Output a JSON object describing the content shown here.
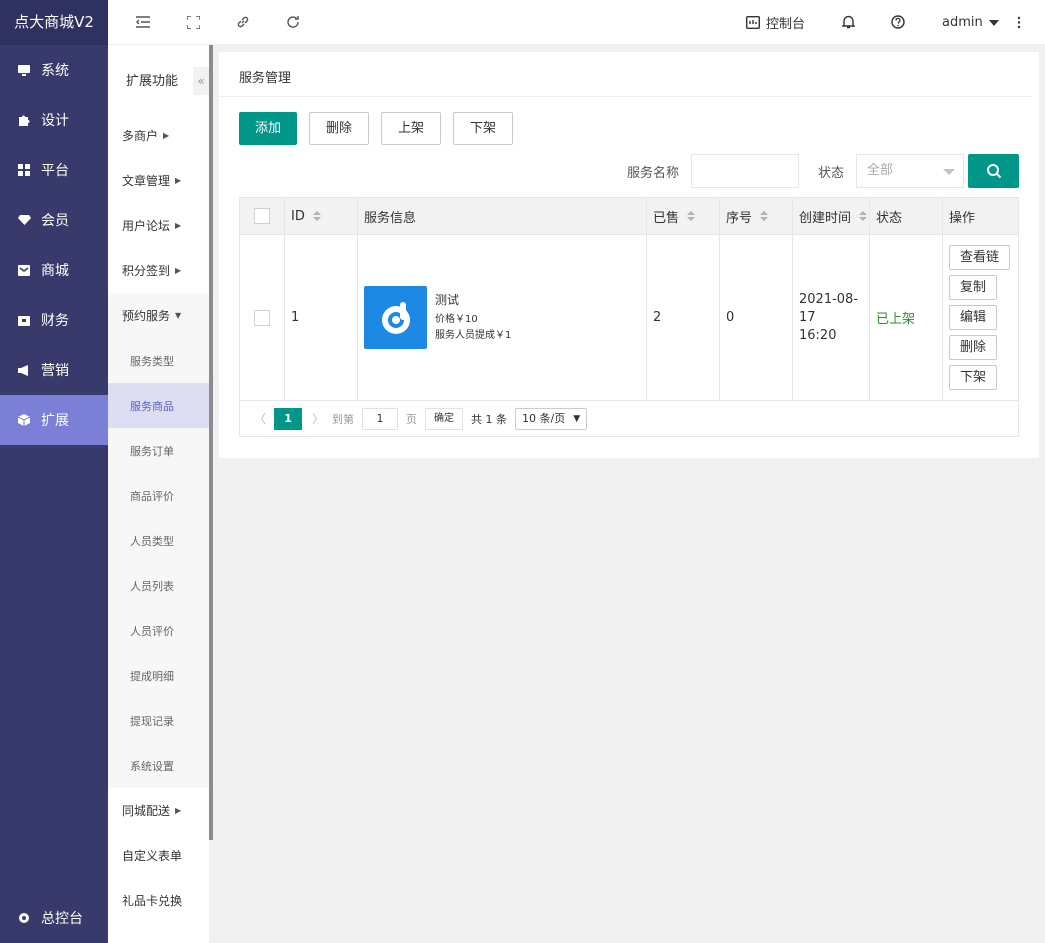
{
  "brand": "点大商城V2",
  "colors": {
    "sidebar": "#383a6b",
    "active": "#7b7fd6",
    "primary": "#009688",
    "status_on": "#2f8f2f"
  },
  "nav": {
    "items": [
      {
        "label": "系统",
        "icon": "monitor-icon"
      },
      {
        "label": "设计",
        "icon": "puzzle-icon"
      },
      {
        "label": "平台",
        "icon": "grid-icon"
      },
      {
        "label": "会员",
        "icon": "diamond-icon"
      },
      {
        "label": "商城",
        "icon": "mail-icon"
      },
      {
        "label": "财务",
        "icon": "wallet-icon"
      },
      {
        "label": "营销",
        "icon": "megaphone-icon"
      },
      {
        "label": "扩展",
        "icon": "cube-icon"
      }
    ],
    "bottom": "总控台"
  },
  "header": {
    "console": "控制台",
    "user": "admin"
  },
  "subnav": {
    "title": "扩展功能",
    "groups": [
      "多商户",
      "文章管理",
      "用户论坛",
      "积分签到",
      "预约服务"
    ],
    "subs": [
      "服务类型",
      "服务商品",
      "服务订单",
      "商品评价",
      "人员类型",
      "人员列表",
      "人员评价",
      "提成明细",
      "提现记录",
      "系统设置"
    ],
    "after": [
      "同城配送",
      "自定义表单",
      "礼品卡兑换"
    ]
  },
  "page": {
    "title": "服务管理",
    "buttons": {
      "add": "添加",
      "delete": "删除",
      "on": "上架",
      "off": "下架"
    },
    "filters": {
      "name_label": "服务名称",
      "name_value": "",
      "status_label": "状态",
      "status_value": "全部"
    }
  },
  "table": {
    "headers": {
      "id": "ID",
      "info": "服务信息",
      "sold": "已售",
      "seq": "序号",
      "created": "创建时间",
      "status": "状态",
      "ops": "操作"
    },
    "rows": [
      {
        "id": "1",
        "name": "测试",
        "price": "价格￥10",
        "commission": "服务人员提成￥1",
        "sold": "2",
        "seq": "0",
        "created": "2021-08-17",
        "created_time": "16:20",
        "status": "已上架",
        "ops": [
          "查看链",
          "复制",
          "编辑",
          "删除",
          "下架"
        ]
      }
    ]
  },
  "pager": {
    "current": "1",
    "goto_label": "到第",
    "goto_value": "1",
    "page_label": "页",
    "confirm": "确定",
    "total": "共 1 条",
    "size": "10 条/页"
  }
}
